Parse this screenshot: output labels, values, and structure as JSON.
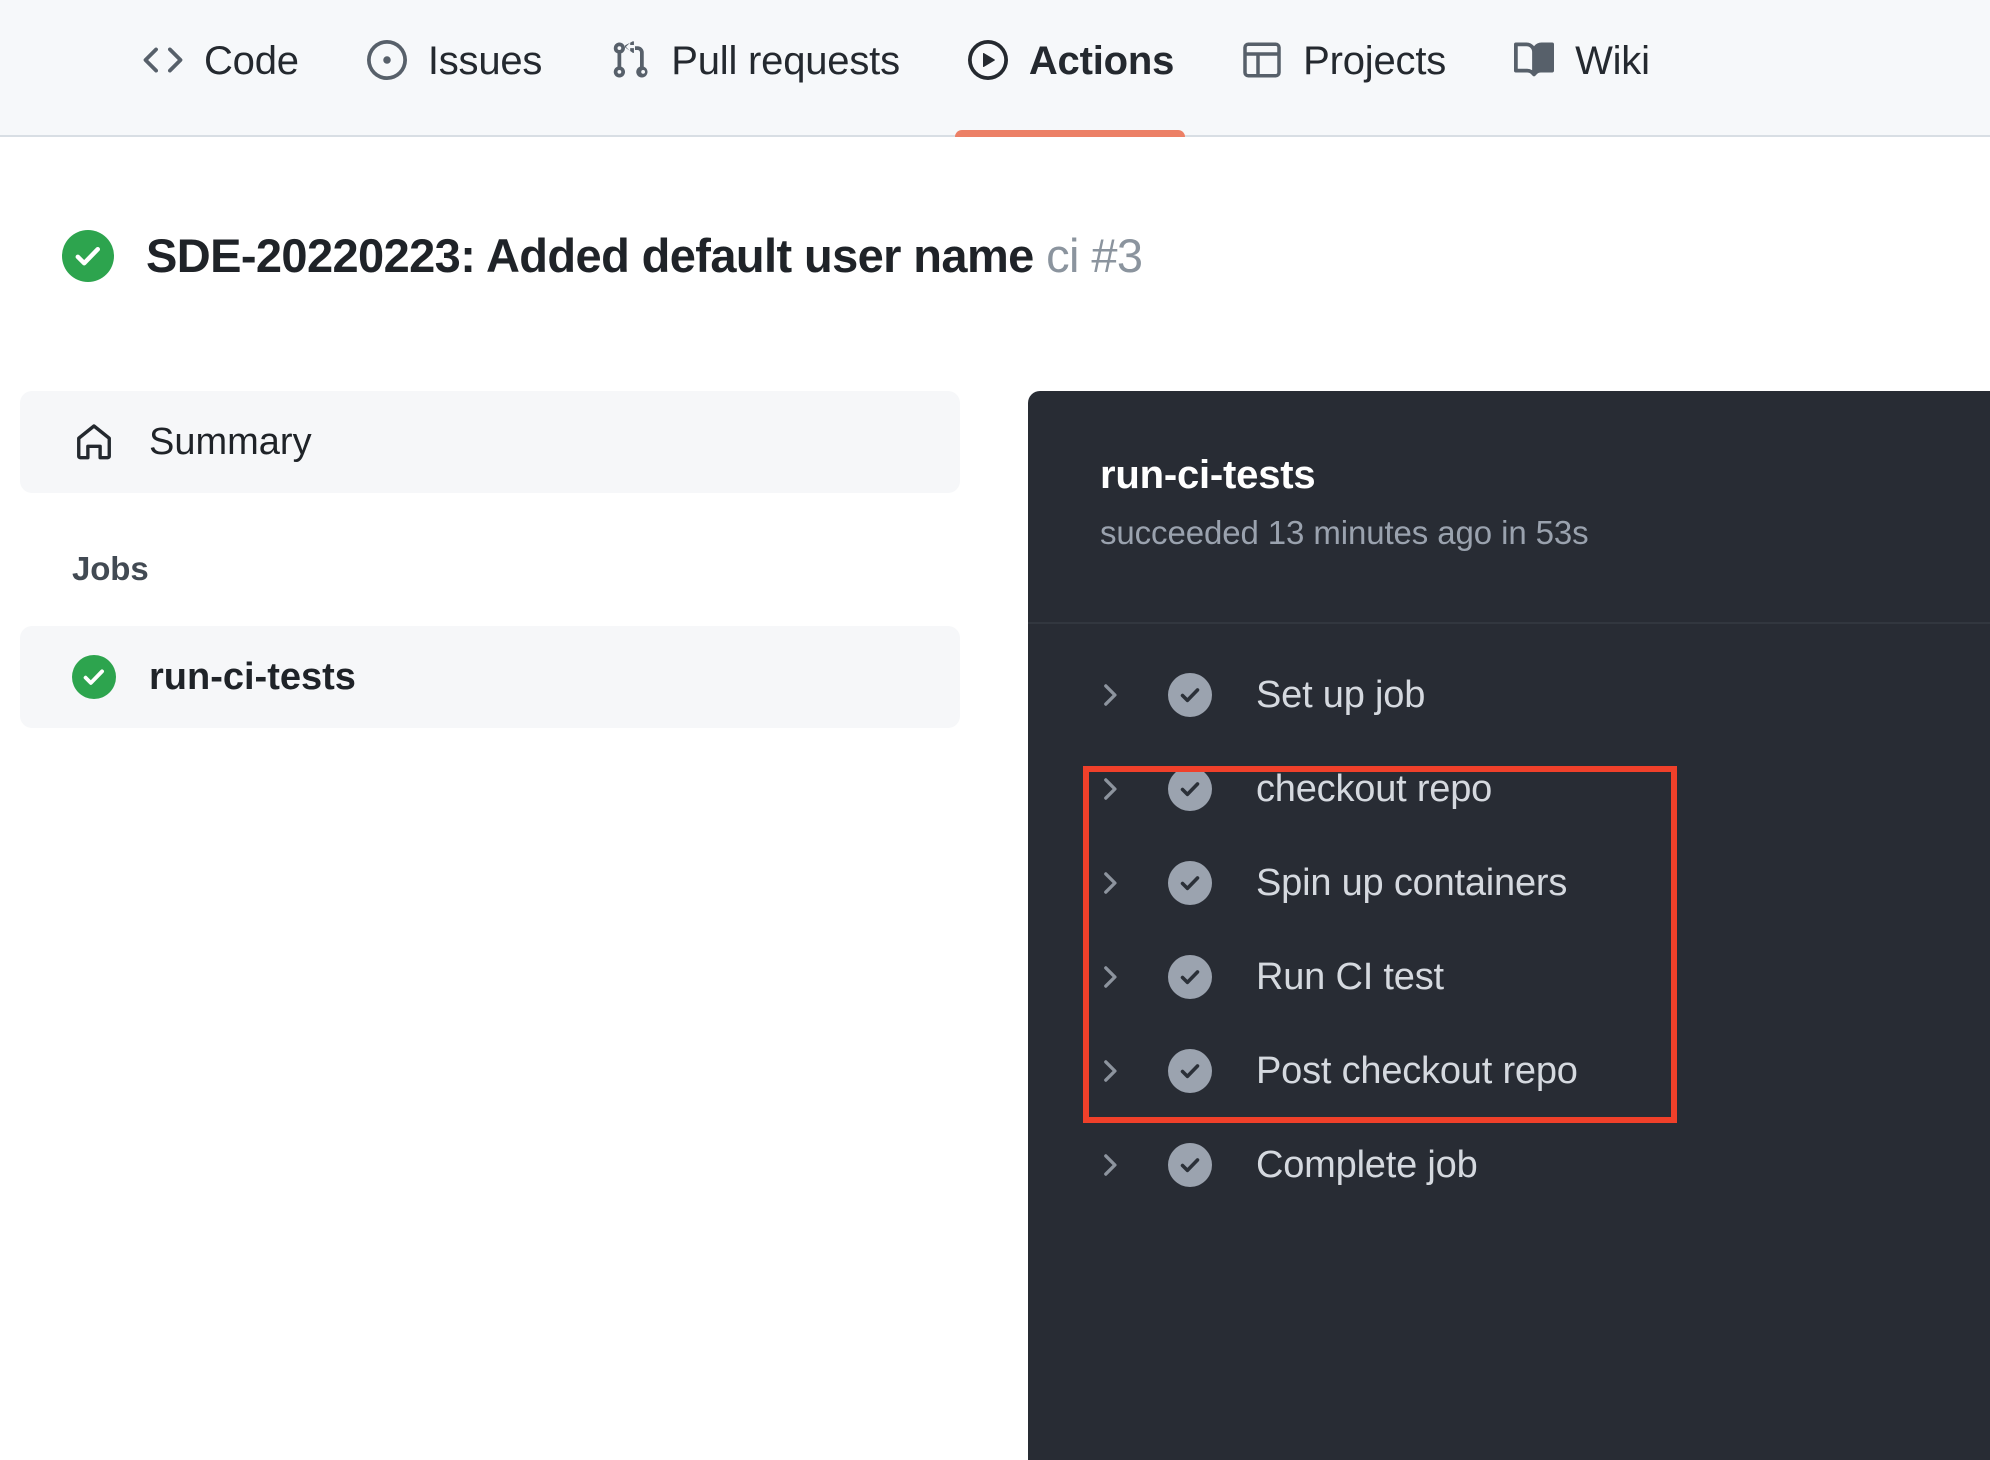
{
  "repo_nav": {
    "tabs": [
      {
        "label": "Code",
        "icon": "code-icon",
        "active": false
      },
      {
        "label": "Issues",
        "icon": "issue-opened-icon",
        "active": false
      },
      {
        "label": "Pull requests",
        "icon": "git-pull-request-icon",
        "active": false
      },
      {
        "label": "Actions",
        "icon": "play-circle-icon",
        "active": true
      },
      {
        "label": "Projects",
        "icon": "table-icon",
        "active": false
      },
      {
        "label": "Wiki",
        "icon": "book-icon",
        "active": false
      }
    ],
    "active_underline_color": "#ec8066"
  },
  "run_header": {
    "status_icon": "check-circle-icon",
    "status_color": "#2da44e",
    "title": "SDE-20220223: Added default user name",
    "run_number": "ci #3"
  },
  "sidebar": {
    "summary": {
      "label": "Summary",
      "icon": "home-icon"
    },
    "jobs_heading": "Jobs",
    "jobs": [
      {
        "label": "run-ci-tests",
        "icon": "check-circle-icon",
        "status_color": "#2da44e"
      }
    ]
  },
  "log_panel": {
    "job_name": "run-ci-tests",
    "job_status": "succeeded 13 minutes ago in 53s",
    "background": "#282c34",
    "steps": [
      {
        "label": "Set up job",
        "chevron": "chevron-right-icon",
        "status": "check-circle-icon"
      },
      {
        "label": "checkout repo",
        "chevron": "chevron-right-icon",
        "status": "check-circle-icon"
      },
      {
        "label": "Spin up containers",
        "chevron": "chevron-right-icon",
        "status": "check-circle-icon"
      },
      {
        "label": "Run CI test",
        "chevron": "chevron-right-icon",
        "status": "check-circle-icon"
      },
      {
        "label": "Post checkout repo",
        "chevron": "chevron-right-icon",
        "status": "check-circle-icon"
      },
      {
        "label": "Complete job",
        "chevron": "chevron-right-icon",
        "status": "check-circle-icon"
      }
    ]
  },
  "annotation": {
    "color": "#f0402a",
    "highlighted_steps": [
      "checkout repo",
      "Spin up containers",
      "Run CI test"
    ]
  }
}
